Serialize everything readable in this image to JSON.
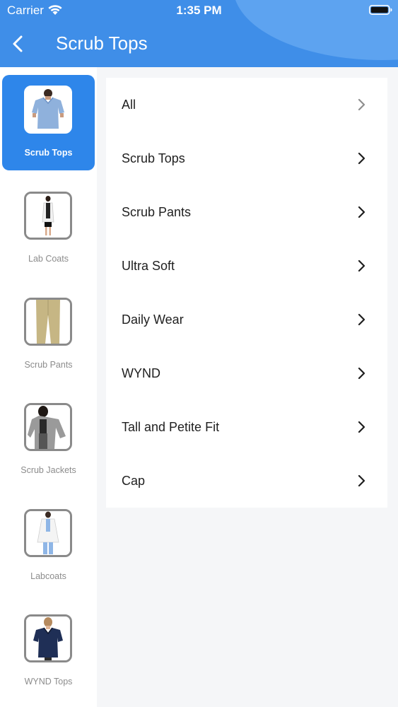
{
  "status_bar": {
    "carrier": "Carrier",
    "time": "1:35 PM"
  },
  "header": {
    "title": "Scrub Tops",
    "back_icon": "chevron-left-icon"
  },
  "colors": {
    "header": "#3f8ee8",
    "active_category": "#2e86ea",
    "background": "#f5f6f8"
  },
  "sidebar": {
    "items": [
      {
        "label": "Scrub Tops",
        "active": true
      },
      {
        "label": "Lab Coats",
        "active": false
      },
      {
        "label": "Scrub Pants",
        "active": false
      },
      {
        "label": "Scrub Jackets",
        "active": false
      },
      {
        "label": "Labcoats",
        "active": false
      },
      {
        "label": "WYND Tops",
        "active": false
      }
    ]
  },
  "subcategories": [
    {
      "label": "All"
    },
    {
      "label": "Scrub Tops"
    },
    {
      "label": "Scrub Pants"
    },
    {
      "label": "Ultra Soft"
    },
    {
      "label": "Daily Wear"
    },
    {
      "label": "WYND"
    },
    {
      "label": "Tall and Petite Fit"
    },
    {
      "label": "Cap"
    }
  ]
}
